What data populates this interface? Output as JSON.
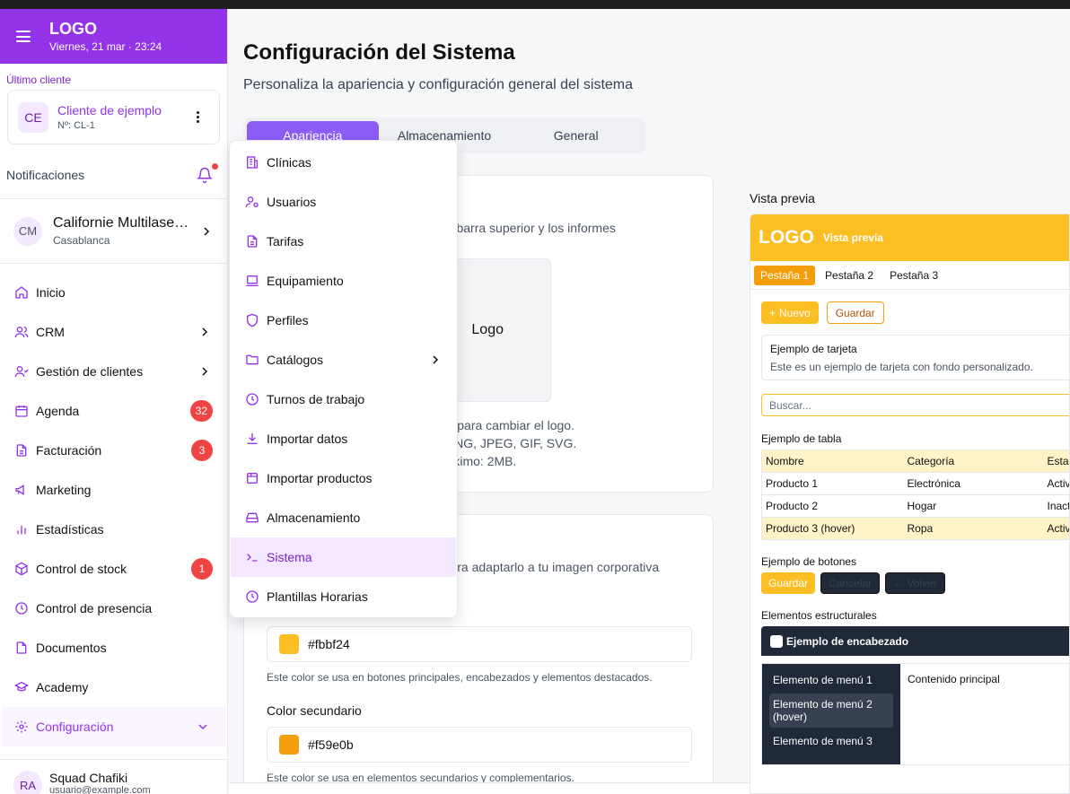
{
  "sidebar": {
    "logo": "LOGO",
    "datetime": "Viernes, 21 mar · 23:24",
    "last_client_label": "Último cliente",
    "client": {
      "initials": "CE",
      "name": "Cliente de ejemplo",
      "id": "Nº: CL-1"
    },
    "notifications_label": "Notificaciones",
    "account": {
      "initials": "CM",
      "name": "Californie Multilase…",
      "location": "Casablanca"
    },
    "items": [
      {
        "label": "Inicio",
        "icon": "home-icon"
      },
      {
        "label": "CRM",
        "icon": "users-icon",
        "chevron": true
      },
      {
        "label": "Gestión de clientes",
        "icon": "user-group-icon",
        "chevron": true
      },
      {
        "label": "Agenda",
        "icon": "calendar-icon",
        "badge": "32"
      },
      {
        "label": "Facturación",
        "icon": "file-icon",
        "badge": "3"
      },
      {
        "label": "Marketing",
        "icon": "megaphone-icon"
      },
      {
        "label": "Estadísticas",
        "icon": "bar-chart-icon"
      },
      {
        "label": "Control de stock",
        "icon": "box-icon",
        "badge": "1"
      },
      {
        "label": "Control de presencia",
        "icon": "clock-icon"
      },
      {
        "label": "Documentos",
        "icon": "document-icon"
      },
      {
        "label": "Academy",
        "icon": "graduation-cap-icon"
      },
      {
        "label": "Configuración",
        "icon": "gear-icon",
        "active": true
      }
    ],
    "user": {
      "initials": "RA",
      "name": "Squad Chafiki",
      "email": "usuario@example.com"
    }
  },
  "main": {
    "title": "Configuración del Sistema",
    "subtitle": "Personaliza la apariencia y configuración general del sistema",
    "tabs": [
      {
        "label": "Apariencia",
        "active": true
      },
      {
        "label": "Almacenamiento"
      },
      {
        "label": "General"
      }
    ],
    "logo_card": {
      "desc": "n la barra superior y los informes",
      "logo_alt": "Logo",
      "upload_info": "gen para cambiar el logo.\ns: PNG, JPEG, GIF, SVG.\n máximo: 2MB."
    },
    "color_card": {
      "desc": "a para adaptarlo a tu imagen corporativa",
      "primary_value": "#fbbf24",
      "primary_help": "Este color se usa en botones principales, encabezados y elementos destacados.",
      "secondary_label": "Color secundario",
      "secondary_value": "#f59e0b",
      "secondary_help": "Este color se usa en elementos secundarios y complementarios."
    }
  },
  "dropdown": {
    "items": [
      {
        "label": "Clínicas",
        "icon": "building-icon"
      },
      {
        "label": "Usuarios",
        "icon": "user-cog-icon"
      },
      {
        "label": "Tarifas",
        "icon": "file-text-icon"
      },
      {
        "label": "Equipamiento",
        "icon": "laptop-icon"
      },
      {
        "label": "Perfiles",
        "icon": "shield-icon"
      },
      {
        "label": "Catálogos",
        "icon": "folder-icon",
        "chevron": true
      },
      {
        "label": "Turnos de trabajo",
        "icon": "clock-icon"
      },
      {
        "label": "Importar datos",
        "icon": "download-icon"
      },
      {
        "label": "Importar productos",
        "icon": "package-icon"
      },
      {
        "label": "Almacenamiento",
        "icon": "hard-drive-icon"
      },
      {
        "label": "Sistema",
        "icon": "terminal-icon",
        "active": true
      },
      {
        "label": "Plantillas Horarias",
        "icon": "clock-icon"
      }
    ]
  },
  "preview": {
    "label": "Vista previa",
    "logo": "LOGO",
    "header_title": "Vista previa",
    "tabs": [
      "Pestaña 1",
      "Pestaña 2",
      "Pestaña 3"
    ],
    "new_button": "Nuevo",
    "save_button": "Guardar",
    "card_title": "Ejemplo de tarjeta",
    "card_desc": "Este es un ejemplo de tarjeta con fondo personalizado.",
    "search_placeholder": "Buscar...",
    "table_title": "Ejemplo de tabla",
    "table": {
      "headers": [
        "Nombre",
        "Categoría",
        "Esta"
      ],
      "rows": [
        [
          "Producto 1",
          "Electrónica",
          "Activ"
        ],
        [
          "Producto 2",
          "Hogar",
          "Inact"
        ],
        [
          "Producto 3 (hover)",
          "Ropa",
          "Activ"
        ]
      ]
    },
    "buttons_title": "Ejemplo de botones",
    "btn_save": "Guardar",
    "btn_cancel": "Cancelar",
    "btn_back": "← Volver",
    "struct_title": "Elementos estructurales",
    "struct_header": "Ejemplo de encabezado",
    "menu_items": [
      "Elemento de menú 1",
      "Elemento de menú 2 (hover)",
      "Elemento de menú 3"
    ],
    "content_label": "Contenido principal"
  },
  "colors": {
    "brand": "#9333ea",
    "primary": "#fbbf24",
    "secondary": "#f59e0b",
    "badge": "#ef4444"
  }
}
